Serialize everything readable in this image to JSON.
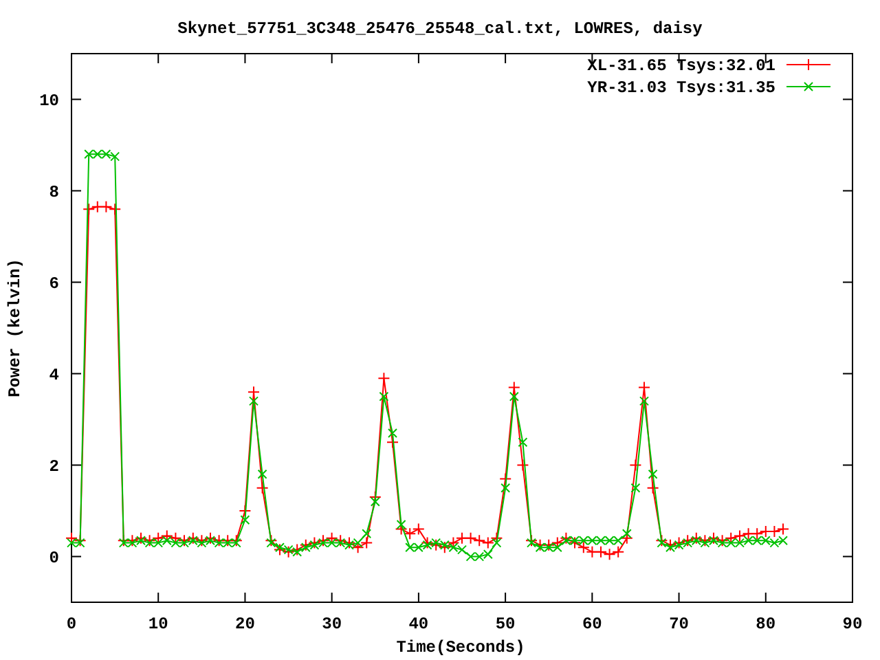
{
  "chart_data": {
    "type": "line",
    "title": "Skynet_57751_3C348_25476_25548_cal.txt, LOWRES, daisy",
    "xlabel": "Time(Seconds)",
    "ylabel": "Power (kelvin)",
    "x": [
      0,
      1,
      2,
      3,
      4,
      5,
      6,
      7,
      8,
      9,
      10,
      11,
      12,
      13,
      14,
      15,
      16,
      17,
      18,
      19,
      20,
      21,
      22,
      23,
      24,
      25,
      26,
      27,
      28,
      29,
      30,
      31,
      32,
      33,
      34,
      35,
      36,
      37,
      38,
      39,
      40,
      41,
      42,
      43,
      44,
      45,
      46,
      47,
      48,
      49,
      50,
      51,
      52,
      53,
      54,
      55,
      56,
      57,
      58,
      59,
      60,
      61,
      62,
      63,
      64,
      65,
      66,
      67,
      68,
      69,
      70,
      71,
      72,
      73,
      74,
      75,
      76,
      77,
      78,
      79,
      80,
      81,
      82
    ],
    "series": [
      {
        "name": "XL-31.65 Tsys:32.01",
        "color": "#ff0000",
        "marker": "plus",
        "values": [
          0.4,
          0.35,
          7.6,
          7.65,
          7.65,
          7.6,
          0.35,
          0.35,
          0.4,
          0.35,
          0.4,
          0.45,
          0.4,
          0.35,
          0.4,
          0.35,
          0.4,
          0.35,
          0.35,
          0.35,
          1.0,
          3.6,
          1.5,
          0.35,
          0.15,
          0.1,
          0.15,
          0.25,
          0.3,
          0.35,
          0.4,
          0.35,
          0.3,
          0.2,
          0.3,
          1.3,
          3.9,
          2.5,
          0.6,
          0.5,
          0.6,
          0.3,
          0.25,
          0.2,
          0.3,
          0.4,
          0.4,
          0.35,
          0.3,
          0.4,
          1.7,
          3.7,
          2.0,
          0.35,
          0.25,
          0.25,
          0.3,
          0.4,
          0.3,
          0.2,
          0.1,
          0.1,
          0.05,
          0.1,
          0.4,
          2.0,
          3.7,
          1.5,
          0.35,
          0.25,
          0.3,
          0.35,
          0.4,
          0.35,
          0.4,
          0.35,
          0.4,
          0.45,
          0.5,
          0.5,
          0.55,
          0.55,
          0.6
        ]
      },
      {
        "name": "YR-31.03 Tsys:31.35",
        "color": "#00c000",
        "marker": "cross",
        "values": [
          0.3,
          0.3,
          8.8,
          8.8,
          8.8,
          8.75,
          0.3,
          0.3,
          0.35,
          0.3,
          0.3,
          0.35,
          0.3,
          0.3,
          0.35,
          0.3,
          0.35,
          0.3,
          0.3,
          0.3,
          0.8,
          3.4,
          1.8,
          0.3,
          0.2,
          0.15,
          0.1,
          0.2,
          0.25,
          0.3,
          0.3,
          0.3,
          0.25,
          0.3,
          0.5,
          1.2,
          3.5,
          2.7,
          0.7,
          0.2,
          0.2,
          0.25,
          0.3,
          0.25,
          0.2,
          0.15,
          0.0,
          0.0,
          0.05,
          0.3,
          1.5,
          3.5,
          2.5,
          0.3,
          0.2,
          0.2,
          0.2,
          0.35,
          0.35,
          0.35,
          0.35,
          0.35,
          0.35,
          0.35,
          0.5,
          1.5,
          3.4,
          1.8,
          0.3,
          0.2,
          0.25,
          0.3,
          0.35,
          0.3,
          0.35,
          0.3,
          0.3,
          0.3,
          0.35,
          0.35,
          0.35,
          0.3,
          0.35
        ]
      }
    ],
    "legend": true,
    "xlim": [
      0,
      90
    ],
    "ylim": [
      -1,
      11
    ],
    "xticks": [
      0,
      10,
      20,
      30,
      40,
      50,
      60,
      70,
      80,
      90
    ],
    "yticks": [
      0,
      2,
      4,
      6,
      8,
      10
    ]
  }
}
